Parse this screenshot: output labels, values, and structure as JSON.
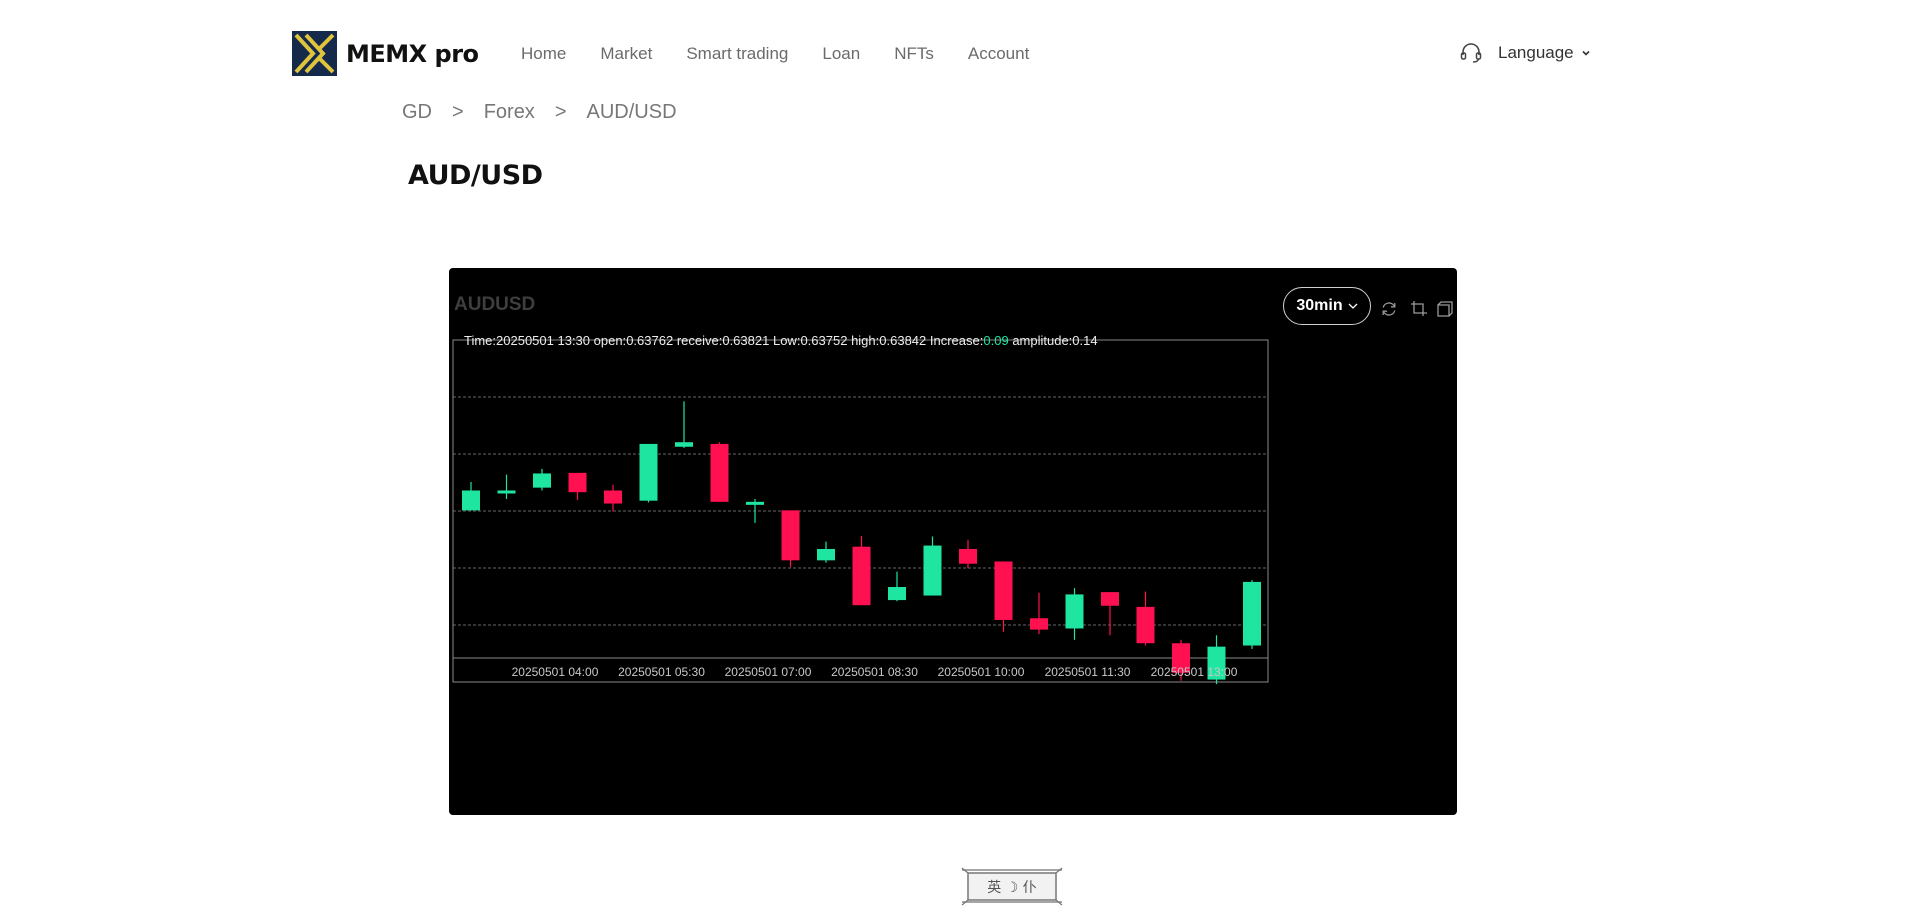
{
  "brand": {
    "name": "MEMX pro"
  },
  "nav": {
    "items": [
      "Home",
      "Market",
      "Smart trading",
      "Loan",
      "NFTs",
      "Account"
    ],
    "language_label": "Language"
  },
  "breadcrumb": {
    "items": [
      "GD",
      "Forex",
      "AUD/USD"
    ],
    "separator": ">"
  },
  "page": {
    "title": "AUD/USD"
  },
  "colors": {
    "up": "#1ee6a0",
    "down": "#ff1050",
    "panel_bg": "#000000",
    "grid": "#888888"
  },
  "chart_header": {
    "symbol": "AUDUSD",
    "interval": "30min",
    "info": {
      "time_label": "Time:",
      "time": "20250501 13:30",
      "open_label": "open:",
      "open": "0.63762",
      "receive_label": "receive:",
      "receive": "0.63821",
      "low_label": "Low:",
      "low": "0.63752",
      "high_label": "high:",
      "high": "0.63842",
      "increase_label": "Increase:",
      "increase": "0.09",
      "amplitude_label": "amplitude:",
      "amplitude": "0.14"
    }
  },
  "chart_data": {
    "type": "candlestick",
    "title": "AUDUSD",
    "grid": true,
    "ylim": [
      0.6367,
      0.6423
    ],
    "x_tick_labels": [
      "20250501 04:00",
      "20250501 05:30",
      "20250501 07:00",
      "20250501 08:30",
      "20250501 10:00",
      "20250501 11:30",
      "20250501 13:00"
    ],
    "x_tick_index": [
      2,
      5,
      8,
      11,
      14,
      17,
      20
    ],
    "candles": [
      {
        "open": 0.6393,
        "close": 0.63965,
        "high": 0.6398,
        "low": 0.6393
      },
      {
        "open": 0.6396,
        "close": 0.63965,
        "high": 0.63993,
        "low": 0.6395
      },
      {
        "open": 0.6397,
        "close": 0.63995,
        "high": 0.64003,
        "low": 0.63965
      },
      {
        "open": 0.63996,
        "close": 0.63962,
        "high": 0.63996,
        "low": 0.63948
      },
      {
        "open": 0.63965,
        "close": 0.63942,
        "high": 0.63975,
        "low": 0.63928
      },
      {
        "open": 0.63947,
        "close": 0.64047,
        "high": 0.64047,
        "low": 0.63944
      },
      {
        "open": 0.64042,
        "close": 0.6405,
        "high": 0.64122,
        "low": 0.6404
      },
      {
        "open": 0.64047,
        "close": 0.63945,
        "high": 0.6405,
        "low": 0.63945
      },
      {
        "open": 0.63942,
        "close": 0.63945,
        "high": 0.6395,
        "low": 0.63908
      },
      {
        "open": 0.6393,
        "close": 0.63842,
        "high": 0.6393,
        "low": 0.6383
      },
      {
        "open": 0.63842,
        "close": 0.63862,
        "high": 0.63875,
        "low": 0.63838
      },
      {
        "open": 0.63866,
        "close": 0.63763,
        "high": 0.63885,
        "low": 0.63763
      },
      {
        "open": 0.63772,
        "close": 0.63795,
        "high": 0.63822,
        "low": 0.6377
      },
      {
        "open": 0.6378,
        "close": 0.63868,
        "high": 0.63884,
        "low": 0.6378
      },
      {
        "open": 0.63862,
        "close": 0.63836,
        "high": 0.63878,
        "low": 0.63828
      },
      {
        "open": 0.6384,
        "close": 0.63737,
        "high": 0.6384,
        "low": 0.63716
      },
      {
        "open": 0.6374,
        "close": 0.6372,
        "high": 0.63785,
        "low": 0.63712
      },
      {
        "open": 0.63722,
        "close": 0.63782,
        "high": 0.63793,
        "low": 0.63702
      },
      {
        "open": 0.63786,
        "close": 0.63762,
        "high": 0.63786,
        "low": 0.6371
      },
      {
        "open": 0.6376,
        "close": 0.63696,
        "high": 0.63787,
        "low": 0.63692
      },
      {
        "open": 0.63696,
        "close": 0.63644,
        "high": 0.63702,
        "low": 0.6363
      },
      {
        "open": 0.63632,
        "close": 0.6369,
        "high": 0.6371,
        "low": 0.63624
      },
      {
        "open": 0.63692,
        "close": 0.63804,
        "high": 0.63807,
        "low": 0.63686
      }
    ]
  },
  "footer_badge": {
    "text": "英 ☽ 仆"
  }
}
